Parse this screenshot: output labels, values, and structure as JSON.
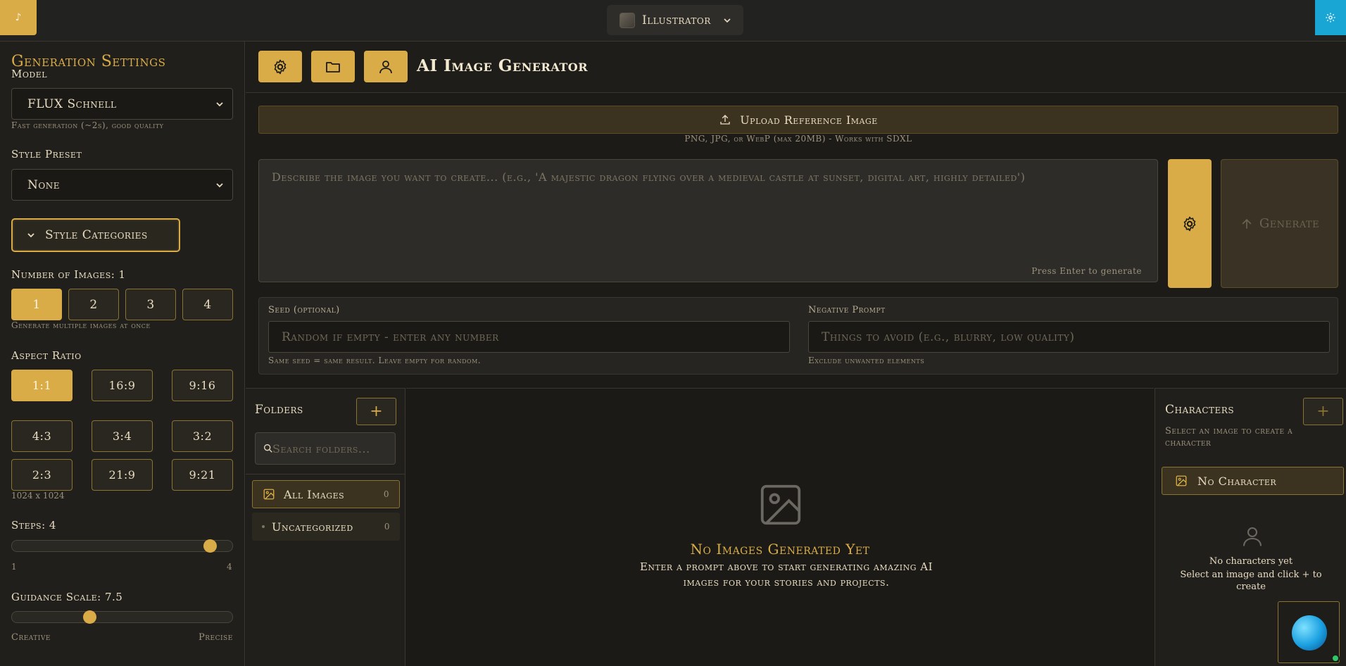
{
  "topbar": {
    "back_glyph": "♪",
    "app_name": "Illustrator"
  },
  "sidebar": {
    "title": "Generation Settings",
    "model_label": "Model",
    "model_value": "FLUX Schnell",
    "model_hint": "Fast generation (~2s), good quality",
    "style_label": "Style Preset",
    "style_value": "None",
    "style_categories": "Style Categories",
    "num_images_label": "Number of Images: 1",
    "num_images": [
      "1",
      "2",
      "3",
      "4"
    ],
    "num_images_hint": "Generate multiple images at once",
    "aspect_label": "Aspect Ratio",
    "aspect_ratios": [
      "1:1",
      "16:9",
      "9:16",
      "4:3",
      "3:4",
      "3:2",
      "2:3",
      "21:9",
      "9:21"
    ],
    "aspect_size": "1024 x 1024",
    "steps_label": "Steps: 4",
    "steps_min": "1",
    "steps_max": "4",
    "steps_value": 4,
    "guidance_label": "Guidance Scale: 7.5",
    "guidance_left": "Creative",
    "guidance_right": "Precise",
    "guidance_value": 7.5
  },
  "header": {
    "title": "AI Image Generator"
  },
  "composer": {
    "upload_label": "Upload Reference Image",
    "upload_hint": "PNG, JPG, or WebP (max 20MB) - Works with SDXL",
    "prompt_placeholder": "Describe the image you want to create... (e.g., 'A majestic dragon flying over a medieval castle at sunset, digital art, highly detailed')",
    "prompt_enter_hint": "Press Enter to generate",
    "generate_label": "Generate",
    "seed_label": "Seed (optional)",
    "seed_placeholder": "Random if empty - enter any number",
    "seed_hint": "Same seed = same result. Leave empty for random.",
    "negative_label": "Negative Prompt",
    "negative_placeholder": "Things to avoid (e.g., blurry, low quality)",
    "negative_hint": "Exclude unwanted elements"
  },
  "folders": {
    "title": "Folders",
    "search_placeholder": "Search folders...",
    "items": [
      {
        "label": "All Images",
        "count": "0"
      },
      {
        "label": "Uncategorized",
        "count": "0"
      }
    ]
  },
  "gallery": {
    "empty_title": "No Images Generated Yet",
    "empty_sub": "Enter a prompt above to start generating amazing AI images for your stories and projects."
  },
  "characters": {
    "title": "Characters",
    "hint": "Select an image to create a character",
    "no_character": "No Character",
    "empty_1": "No characters yet",
    "empty_2": "Select an image and click + to create"
  },
  "colors": {
    "accent": "#d9ac47",
    "background": "#1c1b18",
    "widget_blue": "#1aa6d4",
    "online_green": "#2ec866"
  }
}
